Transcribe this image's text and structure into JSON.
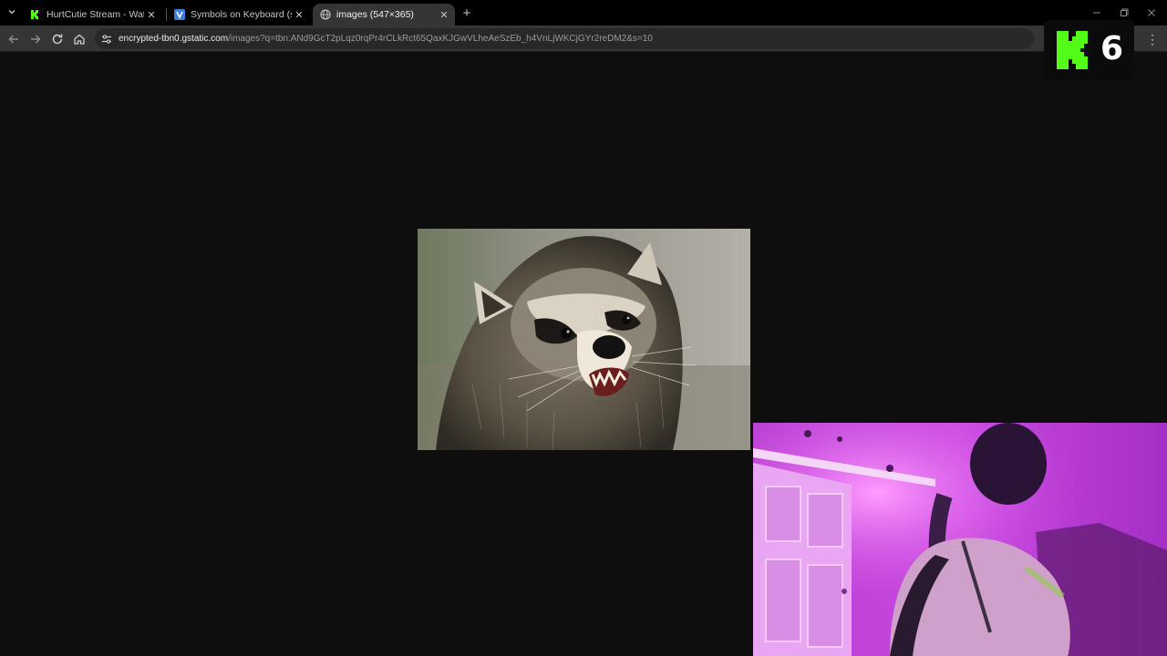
{
  "browser": {
    "tabs": [
      {
        "title": "HurtCutie Stream - Watch Live",
        "favicon": "kick-icon",
        "active": false
      },
      {
        "title": "Symbols on Keyboard (shortcut",
        "favicon": "v-icon",
        "active": false
      },
      {
        "title": "images (547×365)",
        "favicon": "globe-icon",
        "active": true
      }
    ],
    "address_bar": {
      "host": "encrypted-tbn0.gstatic.com",
      "path": "/images?q=tbn:ANd9GcT2pLqz0rqPr4rCLkRct65QaxKJGwVLheAeSzEb_h4VnLjWKCjGYr2reDM2&s=10"
    },
    "icons": {
      "tab_list": "chevron-down-icon",
      "new_tab": "plus-icon",
      "back": "arrow-left-icon",
      "forward": "arrow-right-icon",
      "reload": "reload-icon",
      "home": "home-icon",
      "site_info": "tune-icon",
      "menu": "kebab-icon",
      "minimize": "minimize-icon",
      "maximize": "restore-icon",
      "close": "close-icon"
    }
  },
  "content": {
    "image": "raccoon-photo"
  },
  "overlay": {
    "badge_number": "6",
    "badge_logo": "kick-logo",
    "webcam": "webcam-feed"
  },
  "colors": {
    "accent_green": "#53fc18",
    "tab_active": "#353535",
    "page_bg": "#0e0e0e",
    "webcam_tint": "#c23cd8"
  }
}
